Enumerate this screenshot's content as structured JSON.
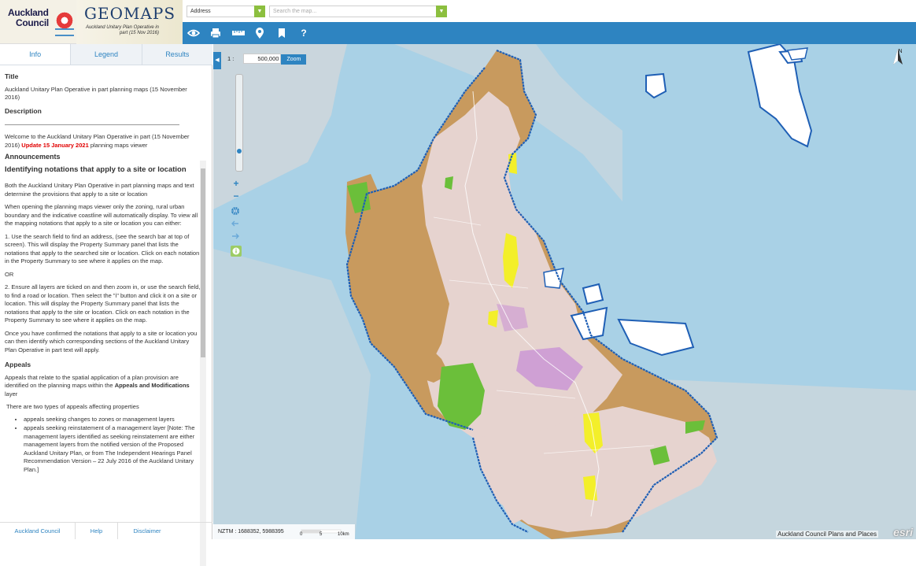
{
  "header": {
    "council_name_line1": "Auckland",
    "council_name_line2": "Council",
    "app_title": "GEOMAPS",
    "app_subtitle": "Auckland Unitary Plan Operative in part (15 Nov 2016)",
    "address_select": "Address",
    "search_placeholder": "Search the map..."
  },
  "toolbar": {
    "tools": [
      "eye-icon",
      "print-icon",
      "measure-icon",
      "location-pin-icon",
      "bookmark-icon",
      "help-icon"
    ],
    "help_label": "?"
  },
  "tabs": [
    {
      "label": "Info",
      "active": true
    },
    {
      "label": "Legend",
      "active": false
    },
    {
      "label": "Results",
      "active": false
    }
  ],
  "info": {
    "title_heading": "Title",
    "title_text": "Auckland Unitary Plan Operative in part planning maps (15 November 2016)",
    "description_heading": "Description",
    "welcome_text": "Welcome to the Auckland Unitary Plan Operative in part (15 November 2016)",
    "update_text": "Update 15 January 2021",
    "welcome_tail": "planning maps viewer",
    "announcements_heading": "Announcements",
    "identifying_heading": "Identifying notations that apply to a site or location",
    "p1": "Both the Auckland Unitary Plan Operative in part planning maps and text determine the provisions that apply to a site or location",
    "p2": "When opening the planning maps viewer only the zoning, rural urban boundary and the indicative coastline will automatically display. To view all the mapping notations that apply to a site or location you can either:",
    "p3": "1. Use the search field to find an address, (see the search bar at top of screen). This will display the Property Summary panel that lists the notations that apply to the searched site or location. Click on each notation in the Property Summary to see where it applies on the map.",
    "or_text": "OR",
    "p4": "2. Ensure all layers are ticked on and then zoom in, or use the search field, to find a road or location. Then select the \"i\" button and click it on a site or location. This will display the Property Summary panel that lists the notations that apply to the site or location. Click on each notation in the Property Summary to see where it applies on the map.",
    "p5": "Once you have confirmed the notations that apply to a site or location you can then identify which corresponding sections of the Auckland Unitary Plan Operative in part text will apply.",
    "appeals_heading": "Appeals",
    "p6_start": "Appeals that relate to the spatial application of a plan provision are identified on the planning maps within the",
    "p6_bold": "Appeals and Modifications",
    "p6_end": "layer",
    "p7": "There are two types of appeals affecting properties",
    "bullet1": "appeals seeking changes to zones or management layers",
    "bullet2": "appeals seeking reinstatement of a management layer [Note: The management layers identified as seeking reinstatement are either management layers from the notified version of the Proposed Auckland Unitary Plan, or from The Independent Hearings Panel Recommendation Version – 22 July 2016 of the Auckland Unitary Plan.]"
  },
  "footer": {
    "links": [
      "Auckland Council",
      "Help",
      "Disclaimer"
    ]
  },
  "map": {
    "scale_prefix": "1 :",
    "scale_value": "500,000",
    "zoom_label": "Zoom",
    "zoom_in": "+",
    "zoom_out": "−",
    "north_label": "N",
    "coordinates": "NZTM : 1688352, 5988395",
    "scalebar_labels": [
      "0",
      "5",
      "10km"
    ],
    "attribution": "Auckland Council Plans and Places",
    "esri_label": "esri",
    "colors": {
      "sea": "#a9d1e6",
      "land_outside": "#d9d9d9",
      "rural": "#c89a5e",
      "urban": "#e6d3cf",
      "parks": "#6bbf3a",
      "coastline": "#1f5fb5",
      "highlight": "#f3ef2a"
    }
  }
}
